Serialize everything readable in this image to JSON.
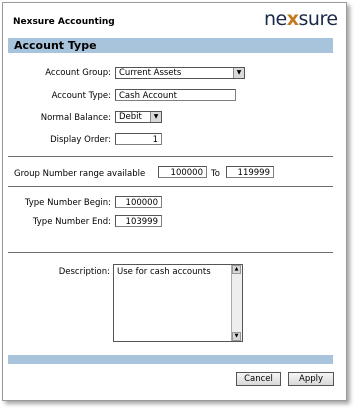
{
  "app_title": "Nexsure Accounting",
  "logo": {
    "part1": "ne",
    "x": "x",
    "part2": "sure"
  },
  "section_title": "Account Type",
  "form": {
    "account_group": {
      "label": "Account Group:",
      "value": "Current Assets"
    },
    "account_type": {
      "label": "Account Type:",
      "value": "Cash Account"
    },
    "normal_balance": {
      "label": "Normal Balance:",
      "value": "Debit"
    },
    "display_order": {
      "label": "Display Order:",
      "value": "1"
    },
    "group_range": {
      "label": "Group Number range available",
      "from": "100000",
      "to_label": "To",
      "to": "119999"
    },
    "type_begin": {
      "label": "Type Number Begin:",
      "value": "100000"
    },
    "type_end": {
      "label": "Type Number End:",
      "value": "103999"
    },
    "description": {
      "label": "Description:",
      "value": "Use for cash accounts"
    }
  },
  "buttons": {
    "cancel": "Cancel",
    "apply": "Apply"
  }
}
